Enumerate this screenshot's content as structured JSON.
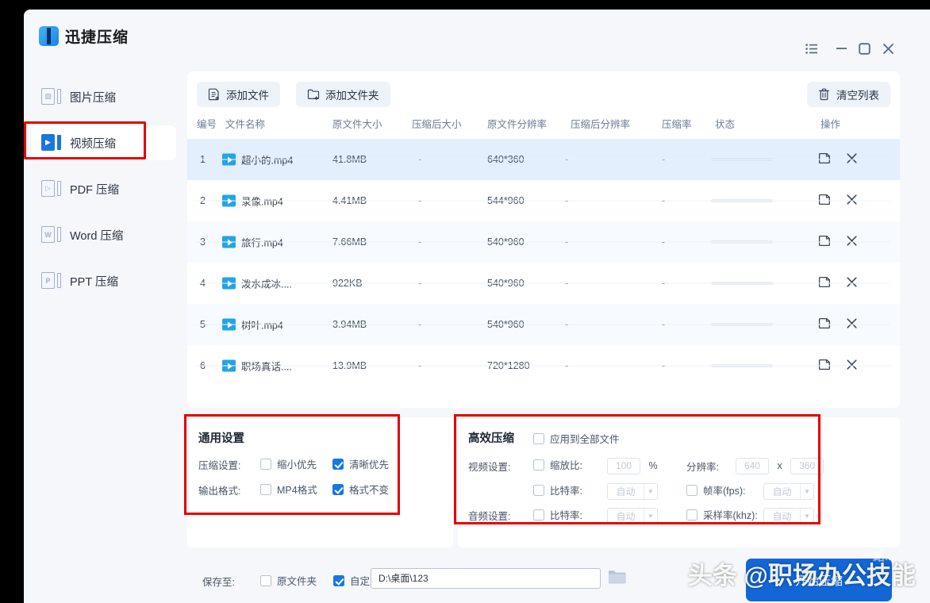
{
  "app": {
    "title": "迅捷压缩",
    "logo_icon": "zip-app-logo-icon"
  },
  "titlebar": {
    "menu_icon": "list-menu-icon",
    "minimize_icon": "minimize-icon",
    "maximize_icon": "maximize-icon",
    "close_icon": "close-icon"
  },
  "sidebar": {
    "items": [
      {
        "label": "图片压缩",
        "glyph": "▨",
        "icon": "image-compress-icon",
        "active": false
      },
      {
        "label": "视频压缩",
        "glyph": "▶",
        "icon": "video-compress-icon",
        "active": true
      },
      {
        "label": "PDF 压缩",
        "glyph": "▷",
        "icon": "pdf-compress-icon",
        "active": false
      },
      {
        "label": "Word 压缩",
        "glyph": "W",
        "icon": "word-compress-icon",
        "active": false
      },
      {
        "label": "PPT 压缩",
        "glyph": "P",
        "icon": "ppt-compress-icon",
        "active": false
      }
    ]
  },
  "toolbar": {
    "add_file_label": "添加文件",
    "add_file_icon": "add-file-icon",
    "add_folder_label": "添加文件夹",
    "add_folder_icon": "add-folder-icon",
    "clear_list_label": "清空列表",
    "clear_list_icon": "trash-icon"
  },
  "table": {
    "headers": [
      "编号",
      "文件名称",
      "原文件大小",
      "压缩后大小",
      "原文件分辨率",
      "压缩后分辨率",
      "压缩率",
      "状态",
      "操作"
    ],
    "rows": [
      {
        "no": "1",
        "name": "超小的.mp4",
        "size": "41.8MB",
        "size_after": "-",
        "res": "640*360",
        "res_after": "-",
        "ratio": "-",
        "status": "",
        "selected": true
      },
      {
        "no": "2",
        "name": "录像.mp4",
        "size": "4.41MB",
        "size_after": "-",
        "res": "544*960",
        "res_after": "-",
        "ratio": "-",
        "status": "",
        "selected": false
      },
      {
        "no": "3",
        "name": "旅行.mp4",
        "size": "7.66MB",
        "size_after": "-",
        "res": "540*960",
        "res_after": "-",
        "ratio": "-",
        "status": "",
        "selected": false
      },
      {
        "no": "4",
        "name": "泼水成冰....",
        "size": "922KB",
        "size_after": "-",
        "res": "540*960",
        "res_after": "-",
        "ratio": "-",
        "status": "",
        "selected": false
      },
      {
        "no": "5",
        "name": "树叶.mp4",
        "size": "3.94MB",
        "size_after": "-",
        "res": "540*960",
        "res_after": "-",
        "ratio": "-",
        "status": "",
        "selected": false
      },
      {
        "no": "6",
        "name": "职场真话....",
        "size": "13.9MB",
        "size_after": "-",
        "res": "720*1280",
        "res_after": "-",
        "ratio": "-",
        "status": "",
        "selected": false
      }
    ],
    "row_icon": "video-play-icon",
    "open_folder_icon": "open-folder-icon",
    "remove_icon": "remove-row-icon"
  },
  "general_settings": {
    "title": "通用设置",
    "compress_label": "压缩设置:",
    "compress_options": [
      {
        "label": "缩小优先",
        "checked": false
      },
      {
        "label": "清晰优先",
        "checked": true
      }
    ],
    "format_label": "输出格式:",
    "format_options": [
      {
        "label": "MP4格式",
        "checked": false
      },
      {
        "label": "格式不变",
        "checked": true
      }
    ]
  },
  "advanced_settings": {
    "title": "高效压缩",
    "apply_all_label": "应用到全部文件",
    "apply_all_checked": false,
    "video_label": "视频设置:",
    "audio_label": "音频设置:",
    "scale_label": "缩放比:",
    "scale_value": "100",
    "scale_unit": "%",
    "resolution_label": "分辨率:",
    "resolution_w": "640",
    "resolution_x": "x",
    "resolution_h": "360",
    "video_bitrate_label": "比特率:",
    "video_bitrate_value": "自动",
    "fps_label": "帧率(fps):",
    "fps_value": "自动",
    "audio_bitrate_label": "比特率:",
    "audio_bitrate_value": "自动",
    "samplerate_label": "采样率(khz):",
    "samplerate_value": "自动",
    "dropdown_icon": "chevron-down-icon"
  },
  "bottom": {
    "save_to_label": "保存至:",
    "original_folder_label": "原文件夹",
    "original_folder_checked": false,
    "custom_label": "自定义",
    "custom_checked": true,
    "path_value": "D:\\桌面\\123",
    "browse_icon": "browse-folder-icon",
    "start_label": "开始压缩"
  },
  "watermark": {
    "text": "头条 @职场办公技能",
    "sub": "一路..."
  },
  "colors": {
    "accent": "#1877e0",
    "start_button": "#1266d6",
    "highlight_box": "#e60000",
    "row_selected": "#e3effc",
    "play_icon": "#22a5e6"
  }
}
